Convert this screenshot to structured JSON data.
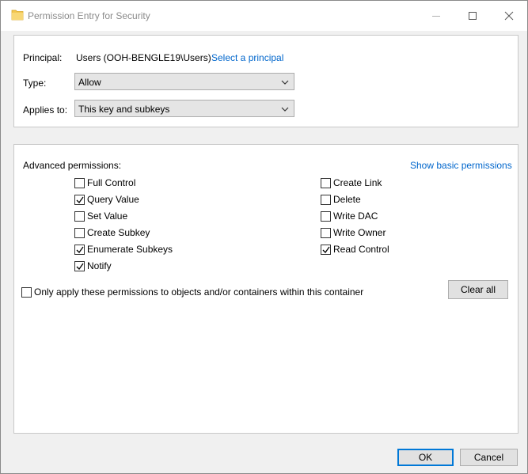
{
  "window": {
    "title": "Permission Entry for Security",
    "icons": {
      "app": "folder-icon",
      "minimize": "minimize-icon",
      "maximize": "maximize-icon",
      "close": "close-icon"
    }
  },
  "principal": {
    "label": "Principal:",
    "value": "Users (OOH-BENGLE19\\Users)",
    "select_link": "Select a principal"
  },
  "type": {
    "label": "Type:",
    "value": "Allow"
  },
  "applies_to": {
    "label": "Applies to:",
    "value": "This key and subkeys"
  },
  "advanced": {
    "label": "Advanced permissions:",
    "show_basic_link": "Show basic permissions",
    "left": [
      {
        "label": "Full Control",
        "checked": false
      },
      {
        "label": "Query Value",
        "checked": true
      },
      {
        "label": "Set Value",
        "checked": false
      },
      {
        "label": "Create Subkey",
        "checked": false
      },
      {
        "label": "Enumerate Subkeys",
        "checked": true
      },
      {
        "label": "Notify",
        "checked": true
      }
    ],
    "right": [
      {
        "label": "Create Link",
        "checked": false
      },
      {
        "label": "Delete",
        "checked": false
      },
      {
        "label": "Write DAC",
        "checked": false
      },
      {
        "label": "Write Owner",
        "checked": false
      },
      {
        "label": "Read Control",
        "checked": true
      }
    ]
  },
  "only_apply": {
    "label": "Only apply these permissions to objects and/or containers within this container",
    "checked": false
  },
  "buttons": {
    "clear_all": "Clear all",
    "ok": "OK",
    "cancel": "Cancel"
  },
  "colors": {
    "link": "#0066cc",
    "default_button_border": "#0078d7",
    "folder": "#f3c64f"
  }
}
